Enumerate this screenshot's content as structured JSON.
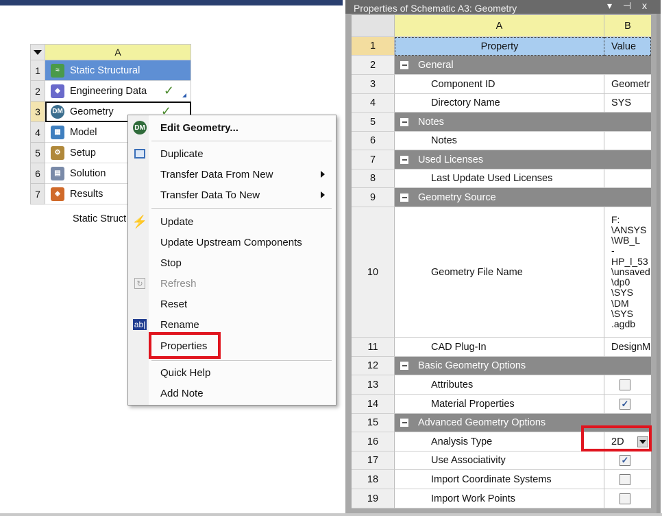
{
  "system": {
    "column_header": "A",
    "rows": [
      {
        "num": "1",
        "label": "Static Structural",
        "icon": "static-structural-icon",
        "status": ""
      },
      {
        "num": "2",
        "label": "Engineering Data",
        "icon": "engineering-data-icon",
        "status": "✓"
      },
      {
        "num": "3",
        "label": "Geometry",
        "icon": "geometry-dm-icon",
        "status": "✓"
      },
      {
        "num": "4",
        "label": "Model",
        "icon": "model-icon",
        "status": ""
      },
      {
        "num": "5",
        "label": "Setup",
        "icon": "setup-icon",
        "status": ""
      },
      {
        "num": "6",
        "label": "Solution",
        "icon": "solution-icon",
        "status": ""
      },
      {
        "num": "7",
        "label": "Results",
        "icon": "results-icon",
        "status": ""
      }
    ],
    "caption": "Static Struct"
  },
  "context_menu": {
    "items": [
      {
        "label": "Edit Geometry...",
        "icon": "dm-icon",
        "bold": true
      },
      {
        "label": "Duplicate",
        "icon": "duplicate-icon"
      },
      {
        "label": "Transfer Data From New",
        "submenu": true
      },
      {
        "label": "Transfer Data To New",
        "submenu": true
      },
      {
        "label": "Update",
        "icon": "update-lightning-icon"
      },
      {
        "label": "Update Upstream Components"
      },
      {
        "label": "Stop"
      },
      {
        "label": "Refresh",
        "icon": "refresh-icon",
        "disabled": true
      },
      {
        "label": "Reset"
      },
      {
        "label": "Rename",
        "icon": "rename-icon",
        "icon_text": "ab|"
      },
      {
        "label": "Properties",
        "highlighted": true
      },
      {
        "label": "Quick Help"
      },
      {
        "label": "Add Note"
      }
    ]
  },
  "properties": {
    "title": "Properties of Schematic A3: Geometry",
    "title_controls": "▾ ⊣ x",
    "col_a": "A",
    "col_b": "B",
    "rows": [
      {
        "n": "1",
        "a": "Property",
        "b": "Value"
      },
      {
        "n": "2",
        "a": "General"
      },
      {
        "n": "3",
        "a": "Component ID",
        "b": "Geometr"
      },
      {
        "n": "4",
        "a": "Directory Name",
        "b": "SYS"
      },
      {
        "n": "5",
        "a": "Notes"
      },
      {
        "n": "6",
        "a": "Notes",
        "b": ""
      },
      {
        "n": "7",
        "a": "Used Licenses"
      },
      {
        "n": "8",
        "a": "Last Update Used Licenses",
        "b": ""
      },
      {
        "n": "9",
        "a": "Geometry Source"
      },
      {
        "n": "10",
        "a": "Geometry File Name",
        "b_lines": [
          "F:",
          "\\ANSYS",
          "\\WB_L",
          "-HP_l_53",
          "\\unsaved",
          "\\dp0",
          "\\SYS",
          "\\DM",
          "\\SYS",
          ".agdb"
        ]
      },
      {
        "n": "11",
        "a": "CAD Plug-In",
        "b": "DesignM"
      },
      {
        "n": "12",
        "a": "Basic Geometry Options"
      },
      {
        "n": "13",
        "a": "Attributes",
        "checked": false
      },
      {
        "n": "14",
        "a": "Material Properties",
        "checked": true
      },
      {
        "n": "15",
        "a": "Advanced Geometry Options"
      },
      {
        "n": "16",
        "a": "Analysis Type",
        "b": "2D"
      },
      {
        "n": "17",
        "a": "Use Associativity",
        "checked": true
      },
      {
        "n": "18",
        "a": "Import Coordinate Systems",
        "checked": false
      },
      {
        "n": "19",
        "a": "Import Work Points",
        "checked": false
      }
    ]
  },
  "colors": {
    "accent_red": "#e0141e",
    "system_header_blue": "#5e8fd4",
    "group_gray": "#8a8a8a"
  }
}
